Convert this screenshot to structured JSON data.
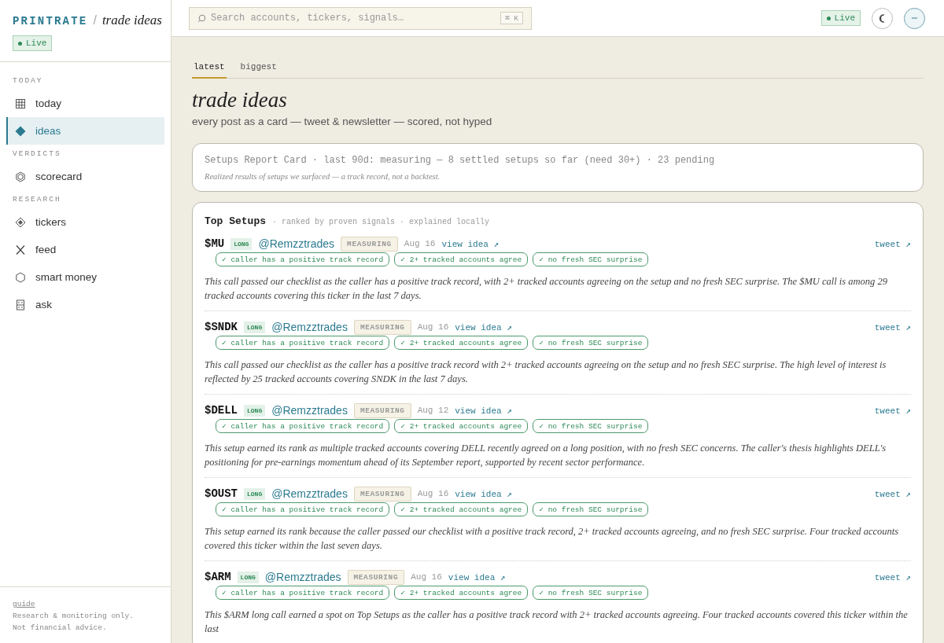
{
  "brand": {
    "name": "PRINTRATE",
    "separator": "/",
    "section": "trade ideas",
    "status": "Live"
  },
  "sidebar": {
    "groups": [
      {
        "heading": "TODAY",
        "items": [
          {
            "label": "today",
            "selected": false
          },
          {
            "label": "ideas",
            "selected": true
          }
        ]
      },
      {
        "heading": "VERDICTS",
        "items": [
          {
            "label": "scorecard",
            "selected": false
          }
        ]
      },
      {
        "heading": "RESEARCH",
        "items": [
          {
            "label": "tickers",
            "selected": false
          },
          {
            "label": "feed",
            "selected": false
          },
          {
            "label": "smart money",
            "selected": false
          },
          {
            "label": "ask",
            "selected": false
          }
        ]
      }
    ],
    "footer": {
      "link": "guide",
      "lines": [
        "Research & monitoring only.",
        "Not financial advice."
      ]
    }
  },
  "topbar": {
    "search": {
      "placeholder": "Search accounts, tickers, signals…",
      "shortcut": "⌘ K"
    },
    "status": "Live"
  },
  "tabs": [
    {
      "label": "latest",
      "selected": true
    },
    {
      "label": "biggest",
      "selected": false
    }
  ],
  "page": {
    "title": "trade ideas",
    "subtitle": "every post as a card — tweet & newsletter — scored, not hyped"
  },
  "report_card": {
    "summary": "Setups Report Card · last 90d: measuring — 8 settled setups so far (need 30+) · 23 pending",
    "note": "Realized results of setups we surfaced — a track record, not a backtest."
  },
  "top_setups": {
    "title": "Top Setups",
    "caption": "· ranked by proven signals · explained locally",
    "ideas": [
      {
        "ticker": "$MU",
        "direction": "LONG",
        "handle": "@Remzztrades",
        "status": "MEASURING",
        "date": "Aug 16",
        "link": "view idea ↗",
        "source": "tweet ↗",
        "checks": [
          "✓ caller has a positive track record",
          "✓ 2+ tracked accounts agree",
          "✓ no fresh SEC surprise"
        ],
        "explanation": "This call passed our checklist as the caller has a positive track record, with 2+ tracked accounts agreeing on the setup and no fresh SEC surprise. The $MU call is among 29 tracked accounts covering this ticker in the last 7 days."
      },
      {
        "ticker": "$SNDK",
        "direction": "LONG",
        "handle": "@Remzztrades",
        "status": "MEASURING",
        "date": "Aug 16",
        "link": "view idea ↗",
        "source": "tweet ↗",
        "checks": [
          "✓ caller has a positive track record",
          "✓ 2+ tracked accounts agree",
          "✓ no fresh SEC surprise"
        ],
        "explanation": "This call passed our checklist as the caller has a positive track record with 2+ tracked accounts agreeing on the setup and no fresh SEC surprise. The high level of interest is reflected by 25 tracked accounts covering SNDK in the last 7 days."
      },
      {
        "ticker": "$DELL",
        "direction": "LONG",
        "handle": "@Remzztrades",
        "status": "MEASURING",
        "date": "Aug 12",
        "link": "view idea ↗",
        "source": "tweet ↗",
        "checks": [
          "✓ caller has a positive track record",
          "✓ 2+ tracked accounts agree",
          "✓ no fresh SEC surprise"
        ],
        "explanation": "This setup earned its rank as multiple tracked accounts covering DELL recently agreed on a long position, with no fresh SEC concerns. The caller's thesis highlights DELL's positioning for pre-earnings momentum ahead of its September report, supported by recent sector performance."
      },
      {
        "ticker": "$OUST",
        "direction": "LONG",
        "handle": "@Remzztrades",
        "status": "MEASURING",
        "date": "Aug 16",
        "link": "view idea ↗",
        "source": "tweet ↗",
        "checks": [
          "✓ caller has a positive track record",
          "✓ 2+ tracked accounts agree",
          "✓ no fresh SEC surprise"
        ],
        "explanation": "This setup earned its rank because the caller passed our checklist with a positive track record, 2+ tracked accounts agreeing, and no fresh SEC surprise. Four tracked accounts covered this ticker within the last seven days."
      },
      {
        "ticker": "$ARM",
        "direction": "LONG",
        "handle": "@Remzztrades",
        "status": "MEASURING",
        "date": "Aug 16",
        "link": "view idea ↗",
        "source": "tweet ↗",
        "checks": [
          "✓ caller has a positive track record",
          "✓ 2+ tracked accounts agree",
          "✓ no fresh SEC surprise"
        ],
        "explanation": "This $ARM long call earned a spot on Top Setups as the caller has a positive track record with 2+ tracked accounts agreeing. Four tracked accounts covered this ticker within the last"
      }
    ]
  }
}
